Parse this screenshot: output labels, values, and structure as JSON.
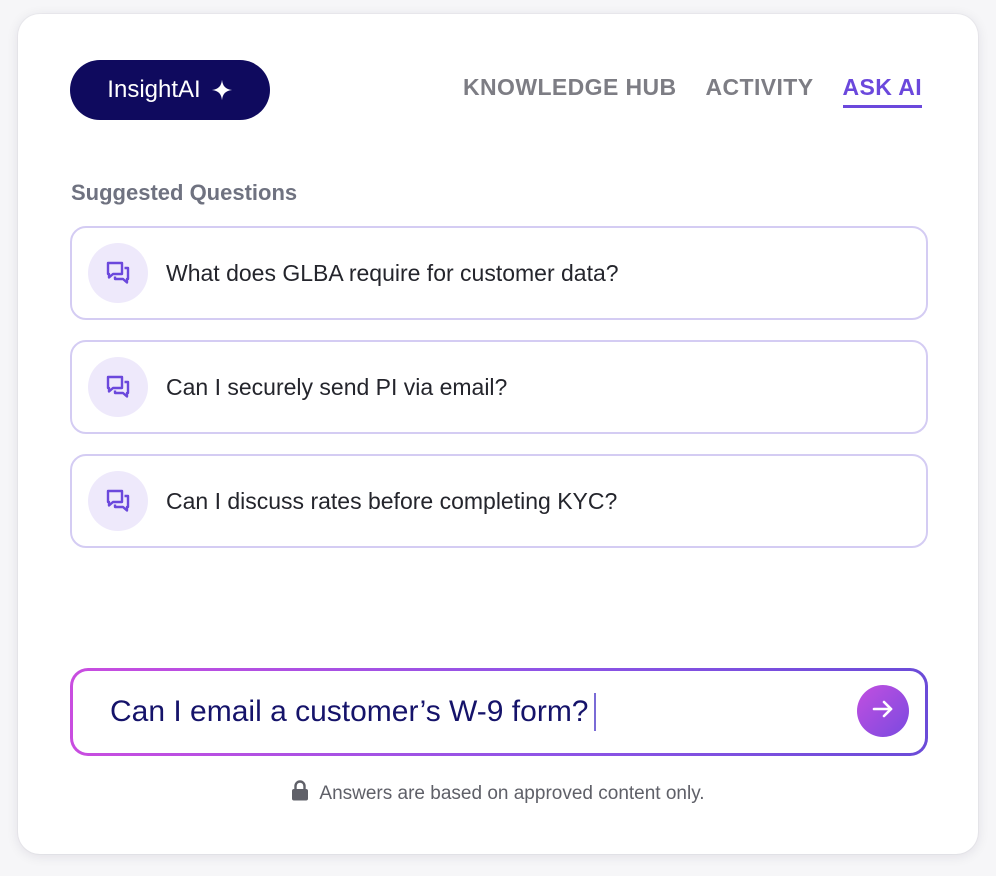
{
  "brand": {
    "name": "InsightAI",
    "icon": "sparkle-icon",
    "color": "#0f0a5e"
  },
  "nav": {
    "tabs": [
      {
        "label": "KNOWLEDGE HUB",
        "active": false
      },
      {
        "label": "ACTIVITY",
        "active": false
      },
      {
        "label": "ASK AI",
        "active": true
      }
    ],
    "active_color": "#6b48dc"
  },
  "suggested": {
    "title": "Suggested Questions",
    "icon": "chat-bubbles-icon",
    "items": [
      {
        "text": "What does GLBA require for customer data?"
      },
      {
        "text": "Can I securely send PI via email?"
      },
      {
        "text": "Can I discuss rates before completing KYC?"
      }
    ]
  },
  "ask": {
    "value": "Can I email a customer’s W-9 form?",
    "send_icon": "arrow-right-icon"
  },
  "footer": {
    "icon": "lock-icon",
    "note": "Answers are based on approved content only."
  }
}
